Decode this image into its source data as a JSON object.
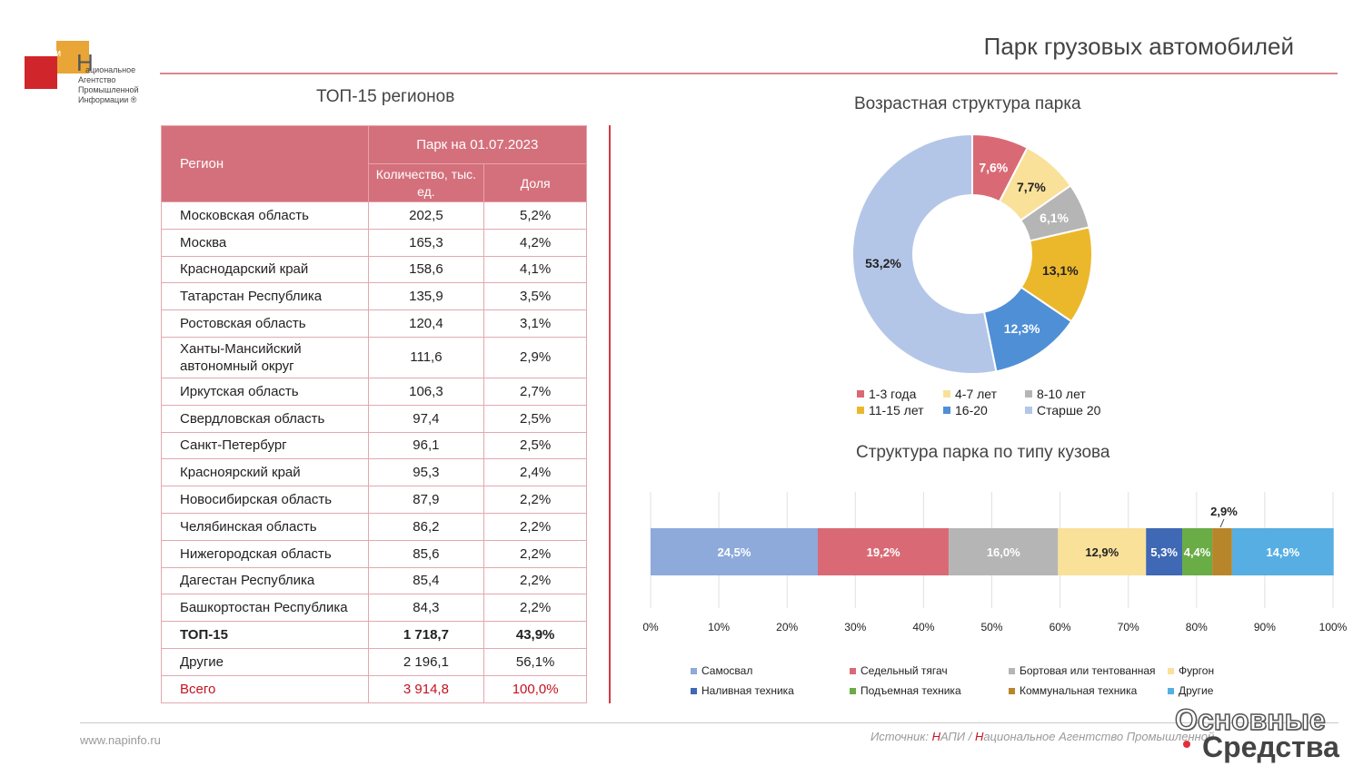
{
  "logo": {
    "abbr": "НАПИ",
    "letter": "Н",
    "lines": [
      "ациональное",
      "Агентство",
      "Промышленной",
      "Информации ®"
    ]
  },
  "slide_title": "Парк грузовых автомобилей",
  "table": {
    "title": "ТОП-15 регионов",
    "header": {
      "region": "Регион",
      "group": "Парк на 01.07.2023",
      "count": "Количество, тыс. ед.",
      "share": "Доля"
    },
    "rows": [
      {
        "name": "Московская область",
        "count": "202,5",
        "share": "5,2%"
      },
      {
        "name": "Москва",
        "count": "165,3",
        "share": "4,2%"
      },
      {
        "name": "Краснодарский край",
        "count": "158,6",
        "share": "4,1%"
      },
      {
        "name": "Татарстан Республика",
        "count": "135,9",
        "share": "3,5%"
      },
      {
        "name": "Ростовская область",
        "count": "120,4",
        "share": "3,1%"
      },
      {
        "name": "Ханты-Мансийский автономный округ",
        "count": "111,6",
        "share": "2,9%"
      },
      {
        "name": "Иркутская область",
        "count": "106,3",
        "share": "2,7%"
      },
      {
        "name": "Свердловская область",
        "count": "97,4",
        "share": "2,5%"
      },
      {
        "name": "Санкт-Петербург",
        "count": "96,1",
        "share": "2,5%"
      },
      {
        "name": "Красноярский край",
        "count": "95,3",
        "share": "2,4%"
      },
      {
        "name": "Новосибирская область",
        "count": "87,9",
        "share": "2,2%"
      },
      {
        "name": "Челябинская область",
        "count": "86,2",
        "share": "2,2%"
      },
      {
        "name": "Нижегородская область",
        "count": "85,6",
        "share": "2,2%"
      },
      {
        "name": "Дагестан Республика",
        "count": "85,4",
        "share": "2,2%"
      },
      {
        "name": "Башкортостан Республика",
        "count": "84,3",
        "share": "2,2%"
      }
    ],
    "top15": {
      "name": "ТОП-15",
      "count": "1 718,7",
      "share": "43,9%"
    },
    "others": {
      "name": "Другие",
      "count": "2 196,1",
      "share": "56,1%"
    },
    "total": {
      "name": "Всего",
      "count": "3 914,8",
      "share": "100,0%"
    }
  },
  "chart_data": [
    {
      "type": "pie",
      "title": "Возрастная структура парка",
      "categories": [
        "1-3 года",
        "4-7 лет",
        "8-10 лет",
        "11-15 лет",
        "16-20",
        "Старше 20"
      ],
      "values": [
        7.6,
        7.7,
        6.1,
        13.1,
        12.3,
        53.2
      ],
      "labels": [
        "7,6%",
        "7,7%",
        "6,1%",
        "13,1%",
        "12,3%",
        "53,2%"
      ],
      "colors": [
        "#d96a75",
        "#f9e19a",
        "#b5b5b5",
        "#ecb82b",
        "#4f8fd6",
        "#b4c6e7"
      ],
      "donut": true,
      "legend_position": "bottom"
    },
    {
      "type": "bar",
      "orientation": "horizontal",
      "stacked": true,
      "title": "Структура парка по типу кузова",
      "series": [
        {
          "name": "Самосвал",
          "values": [
            24.5
          ],
          "label": "24,5%",
          "color": "#8eaadb"
        },
        {
          "name": "Седельный тягач",
          "values": [
            19.2
          ],
          "label": "19,2%",
          "color": "#d96a75"
        },
        {
          "name": "Бортовая или тентованная",
          "values": [
            16.0
          ],
          "label": "16,0%",
          "color": "#b5b5b5"
        },
        {
          "name": "Фургон",
          "values": [
            12.9
          ],
          "label": "12,9%",
          "color": "#f9e19a"
        },
        {
          "name": "Наливная техника",
          "values": [
            5.3
          ],
          "label": "5,3%",
          "color": "#3f68b5"
        },
        {
          "name": "Подъемная техника",
          "values": [
            4.4
          ],
          "label": "4,4%",
          "color": "#6aac46"
        },
        {
          "name": "Коммунальная техника",
          "values": [
            2.9
          ],
          "label": "2,9%",
          "color": "#b8862a"
        },
        {
          "name": "Другие",
          "values": [
            14.9
          ],
          "label": "14,9%",
          "color": "#56aee2"
        }
      ],
      "xlim": [
        0,
        100
      ],
      "ticks": [
        "0%",
        "10%",
        "20%",
        "30%",
        "40%",
        "50%",
        "60%",
        "70%",
        "80%",
        "90%",
        "100%"
      ],
      "grid": true,
      "legend_position": "bottom"
    }
  ],
  "footer": {
    "url": "www.napinfo.ru",
    "source_prefix": "Источник: ",
    "source_n1": "Н",
    "source_mid": "АПИ / ",
    "source_n2": "Н",
    "source_rest": "ациональное Агентство Промышленной"
  },
  "watermark": {
    "line1": "Основные",
    "line2": "Средства"
  }
}
